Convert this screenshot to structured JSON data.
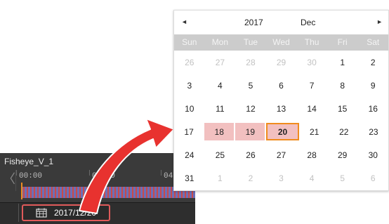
{
  "timeline": {
    "title": "Fisheye_V_1",
    "times": [
      "00:00",
      "02:00",
      "04"
    ],
    "date_button_label": "2017/12/20"
  },
  "calendar": {
    "year": "2017",
    "month": "Dec",
    "prev_label": "◄",
    "next_label": "►",
    "weekdays": [
      "Sun",
      "Mon",
      "Tue",
      "Wed",
      "Thu",
      "Fri",
      "Sat"
    ],
    "weeks": [
      [
        {
          "d": "26",
          "other": true
        },
        {
          "d": "27",
          "other": true
        },
        {
          "d": "28",
          "other": true
        },
        {
          "d": "29",
          "other": true
        },
        {
          "d": "30",
          "other": true
        },
        {
          "d": "1"
        },
        {
          "d": "2"
        }
      ],
      [
        {
          "d": "3"
        },
        {
          "d": "4"
        },
        {
          "d": "5"
        },
        {
          "d": "6"
        },
        {
          "d": "7"
        },
        {
          "d": "8"
        },
        {
          "d": "9"
        }
      ],
      [
        {
          "d": "10"
        },
        {
          "d": "11"
        },
        {
          "d": "12"
        },
        {
          "d": "13"
        },
        {
          "d": "14"
        },
        {
          "d": "15"
        },
        {
          "d": "16"
        }
      ],
      [
        {
          "d": "17"
        },
        {
          "d": "18",
          "hl": true
        },
        {
          "d": "19",
          "hl": true
        },
        {
          "d": "20",
          "sel": true
        },
        {
          "d": "21"
        },
        {
          "d": "22"
        },
        {
          "d": "23"
        }
      ],
      [
        {
          "d": "24"
        },
        {
          "d": "25"
        },
        {
          "d": "26"
        },
        {
          "d": "27"
        },
        {
          "d": "28"
        },
        {
          "d": "29"
        },
        {
          "d": "30"
        }
      ],
      [
        {
          "d": "31"
        },
        {
          "d": "1",
          "other": true
        },
        {
          "d": "2",
          "other": true
        },
        {
          "d": "3",
          "other": true
        },
        {
          "d": "4",
          "other": true
        },
        {
          "d": "5",
          "other": true
        },
        {
          "d": "6",
          "other": true
        }
      ]
    ]
  },
  "colors": {
    "highlight": "#f2c0c0",
    "selected_border": "#f08c1e",
    "arrow": "#e8322f",
    "button_border": "#e05a5a"
  },
  "icons": {
    "calendar": "calendar-icon",
    "prev": "triangle-left-icon",
    "next": "triangle-right-icon"
  }
}
